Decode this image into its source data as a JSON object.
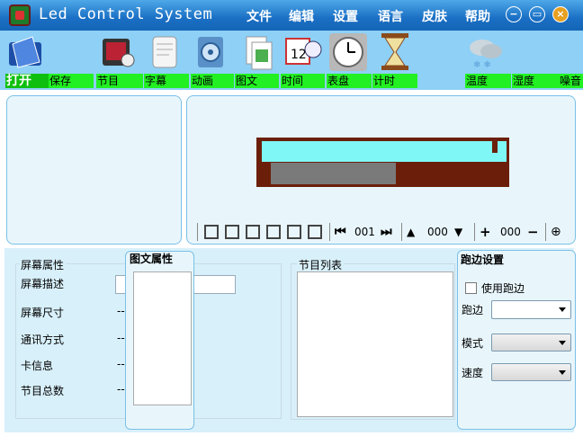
{
  "app": {
    "title": "Led Control System"
  },
  "menu": [
    "文件",
    "编辑",
    "设置",
    "语言",
    "皮肤",
    "帮助"
  ],
  "window_buttons": {
    "minimize": "−",
    "restore": "▭",
    "close": "×"
  },
  "toolbar": {
    "labels": [
      "打开",
      "保存",
      "节目",
      "字幕",
      "动画",
      "图文",
      "时间",
      "表盘",
      "计时",
      "温度",
      "湿度",
      "噪音"
    ],
    "active": "打开"
  },
  "preview_controls": {
    "frame_counter": "001",
    "speed_value": "000",
    "size_value": "000"
  },
  "screen_properties": {
    "group_title": "屏幕属性",
    "rows": [
      {
        "label": "屏幕描述",
        "value": ""
      },
      {
        "label": "屏幕尺寸",
        "value": "--"
      },
      {
        "label": "通讯方式",
        "value": "--"
      },
      {
        "label": "卡信息",
        "value": "--"
      },
      {
        "label": "节目总数",
        "value": "--"
      }
    ]
  },
  "graphic_properties": {
    "title": "图文属性"
  },
  "program_list": {
    "title": "节目列表"
  },
  "border_settings": {
    "title": "跑边设置",
    "use_border_label": "使用跑边",
    "border_label": "跑边",
    "mode_label": "模式",
    "speed_label": "速度"
  },
  "colors": {
    "titlebar": "#1a6fc4",
    "toolbar_bg": "#8ed0f6",
    "label_green": "#22f022",
    "panel_bg": "#e8f6fc",
    "led_frame": "#6b1f0a",
    "led_cyan": "#7ff7f7",
    "led_gray": "#7a7a7a"
  }
}
